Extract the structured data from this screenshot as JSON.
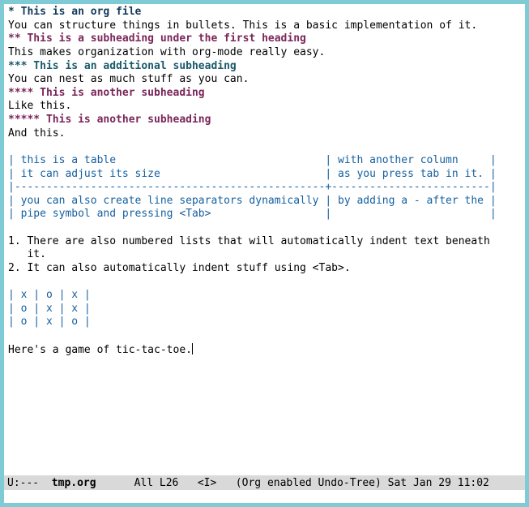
{
  "headings": {
    "h1": "* This is an org file",
    "h1_body": "You can structure things in bullets. This is a basic implementation of it.",
    "h2": "** This is a subheading under the first heading",
    "h2_body": "This makes organization with org-mode really easy.",
    "h3": "*** This is an additional subheading",
    "h3_body": "You can nest as much stuff as you can.",
    "h4": "**** This is another subheading",
    "h4_body": "Like this.",
    "h5": "***** This is another subheading",
    "h5_body": "And this."
  },
  "table1": {
    "r1": "| this is a table                                 | with another column     |",
    "r2": "| it can adjust its size                          | as you press tab in it. |",
    "r3": "|-------------------------------------------------+-------------------------|",
    "r4": "| you can also create line separators dynamically | by adding a - after the |",
    "r5": "| pipe symbol and pressing <Tab>                  |                         |"
  },
  "list": {
    "i1a": "1. There are also numbered lists that will automatically indent text beneath",
    "i1b": "   it.",
    "i2": "2. It can also automatically indent stuff using <Tab>."
  },
  "table2": {
    "r1": "| x | o | x |",
    "r2": "| o | x | x |",
    "r3": "| o | x | o |"
  },
  "footer": "Here's a game of tic-tac-toe.",
  "modeline": {
    "left": "U:---",
    "fname": "  tmp.org",
    "spacer": "      ",
    "pos": "All L26",
    "mode1": "   <I>",
    "mode2": "   (Org enabled Undo-Tree)",
    "time": " Sat Jan 29 11:02"
  }
}
